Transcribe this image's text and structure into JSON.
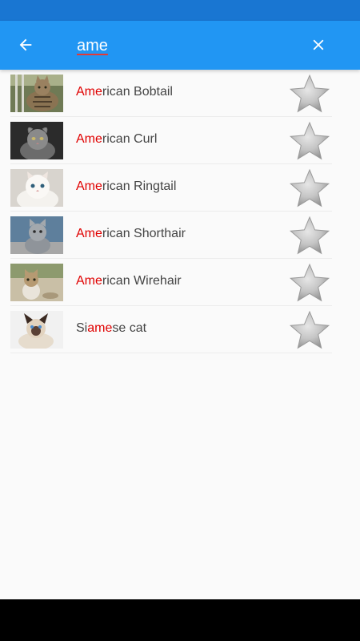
{
  "search": {
    "query": "ame",
    "highlight_color": "#e00000"
  },
  "colors": {
    "app_bar": "#2196f3",
    "status_bar": "#1976d2",
    "background": "#fafafa",
    "nav_bar": "#000000"
  },
  "icons": {
    "back": "arrow-back-icon",
    "clear": "close-icon",
    "favorite": "star-icon"
  },
  "results": [
    {
      "pre": "",
      "match": "Ame",
      "post": "rican Bobtail",
      "favorite": false
    },
    {
      "pre": "",
      "match": "Ame",
      "post": "rican Curl",
      "favorite": false
    },
    {
      "pre": "",
      "match": "Ame",
      "post": "rican Ringtail",
      "favorite": false
    },
    {
      "pre": "",
      "match": "Ame",
      "post": "rican Shorthair",
      "favorite": false
    },
    {
      "pre": "",
      "match": "Ame",
      "post": "rican Wirehair",
      "favorite": false
    },
    {
      "pre": "Si",
      "match": "ame",
      "post": "se cat",
      "favorite": false
    }
  ]
}
